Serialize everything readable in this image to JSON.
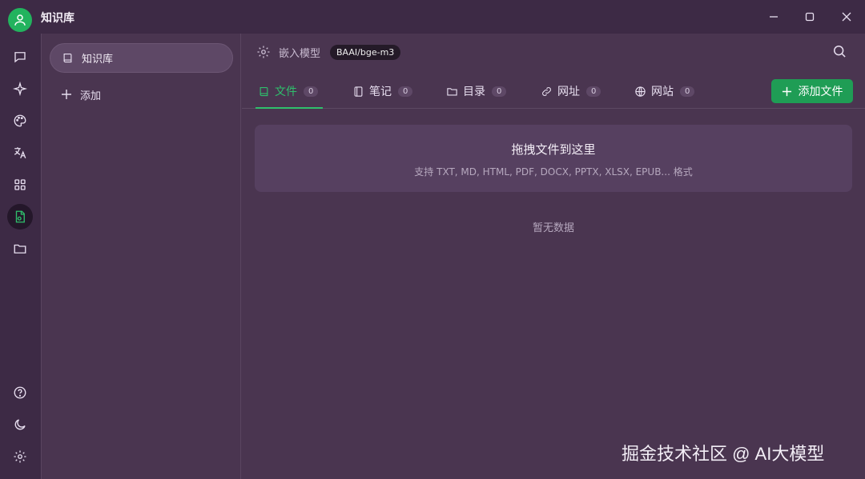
{
  "app": {
    "title": "知识库"
  },
  "sidebar": {
    "selected_item": "知识库",
    "add_label": "添加"
  },
  "main": {
    "model_label": "嵌入模型",
    "model_value": "BAAI/bge-m3",
    "tabs": [
      {
        "label": "文件",
        "count": "0",
        "active": true,
        "icon": "book-icon"
      },
      {
        "label": "笔记",
        "count": "0",
        "active": false,
        "icon": "notebook-icon"
      },
      {
        "label": "目录",
        "count": "0",
        "active": false,
        "icon": "folder-icon"
      },
      {
        "label": "网址",
        "count": "0",
        "active": false,
        "icon": "link-icon"
      },
      {
        "label": "网站",
        "count": "0",
        "active": false,
        "icon": "globe-icon"
      }
    ],
    "add_file_label": "添加文件",
    "dropzone": {
      "title": "拖拽文件到这里",
      "subtitle": "支持 TXT, MD, HTML, PDF, DOCX, PPTX, XLSX, EPUB... 格式"
    },
    "empty_text": "暂无数据"
  },
  "watermark": "掘金技术社区 @ AI大模型",
  "colors": {
    "accent": "#2fbf6c",
    "button": "#1f9d55",
    "background": "#4a3550",
    "sidebar": "#3d2a45"
  }
}
